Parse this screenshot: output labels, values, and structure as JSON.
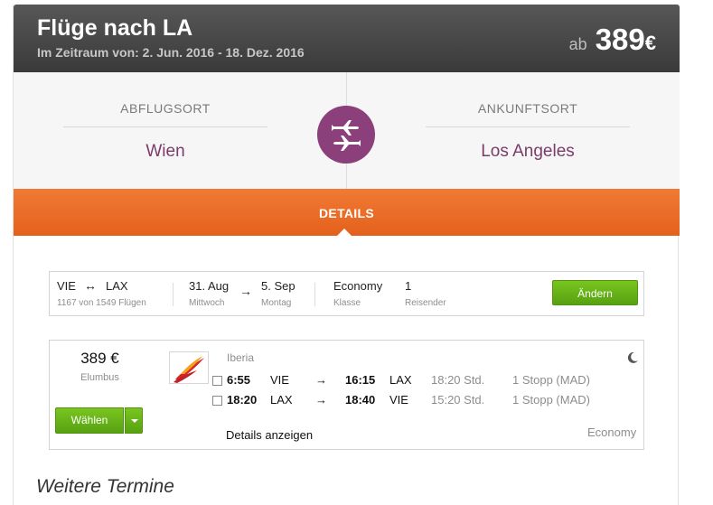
{
  "header": {
    "title": "Flüge nach LA",
    "subtitle": "Im Zeitraum von: 2. Jun. 2016 - 18. Dez. 2016",
    "price_prefix": "ab",
    "price_value": "389",
    "price_currency": "€"
  },
  "route": {
    "origin_label": "ABFLUGSORT",
    "origin_value": "Wien",
    "destination_label": "ANKUNFTSORT",
    "destination_value": "Los Angeles",
    "center_icon": "two-planes-icon"
  },
  "tabs": {
    "details_label": "DETAILS"
  },
  "search": {
    "from_code": "VIE",
    "arrow": "↔",
    "to_code": "LAX",
    "flights_count": "1167 von 1549 Flügen",
    "depart_date": "31. Aug",
    "depart_day": "Mittwoch",
    "date_arrow": "→",
    "return_date": "5. Sep",
    "return_day": "Montag",
    "class_value": "Economy",
    "class_label": "Klasse",
    "travelers_value": "1",
    "travelers_label": "Reisender",
    "change_button": "Ändern"
  },
  "result": {
    "price": "389 €",
    "vendor": "Elumbus",
    "select_button": "Wählen",
    "airline": "Iberia",
    "legs": [
      {
        "dep_time": "6:55",
        "dep_airport": "VIE",
        "arrow": "→",
        "arr_time": "16:15",
        "arr_airport": "LAX",
        "duration": "18:20 Std.",
        "stops": "1 Stopp (MAD)"
      },
      {
        "dep_time": "18:20",
        "dep_airport": "LAX",
        "arrow": "→",
        "arr_time": "18:40",
        "arr_airport": "VIE",
        "duration": "15:20 Std.",
        "stops": "1 Stopp (MAD)"
      }
    ],
    "details_link": "Details anzeigen",
    "cabin_class": "Economy"
  },
  "more": {
    "heading": "Weitere Termine"
  },
  "colors": {
    "header_bg": "#444444",
    "route_accent": "#8b3f7b",
    "orange": "#e8692a",
    "green": "#63ad16"
  }
}
